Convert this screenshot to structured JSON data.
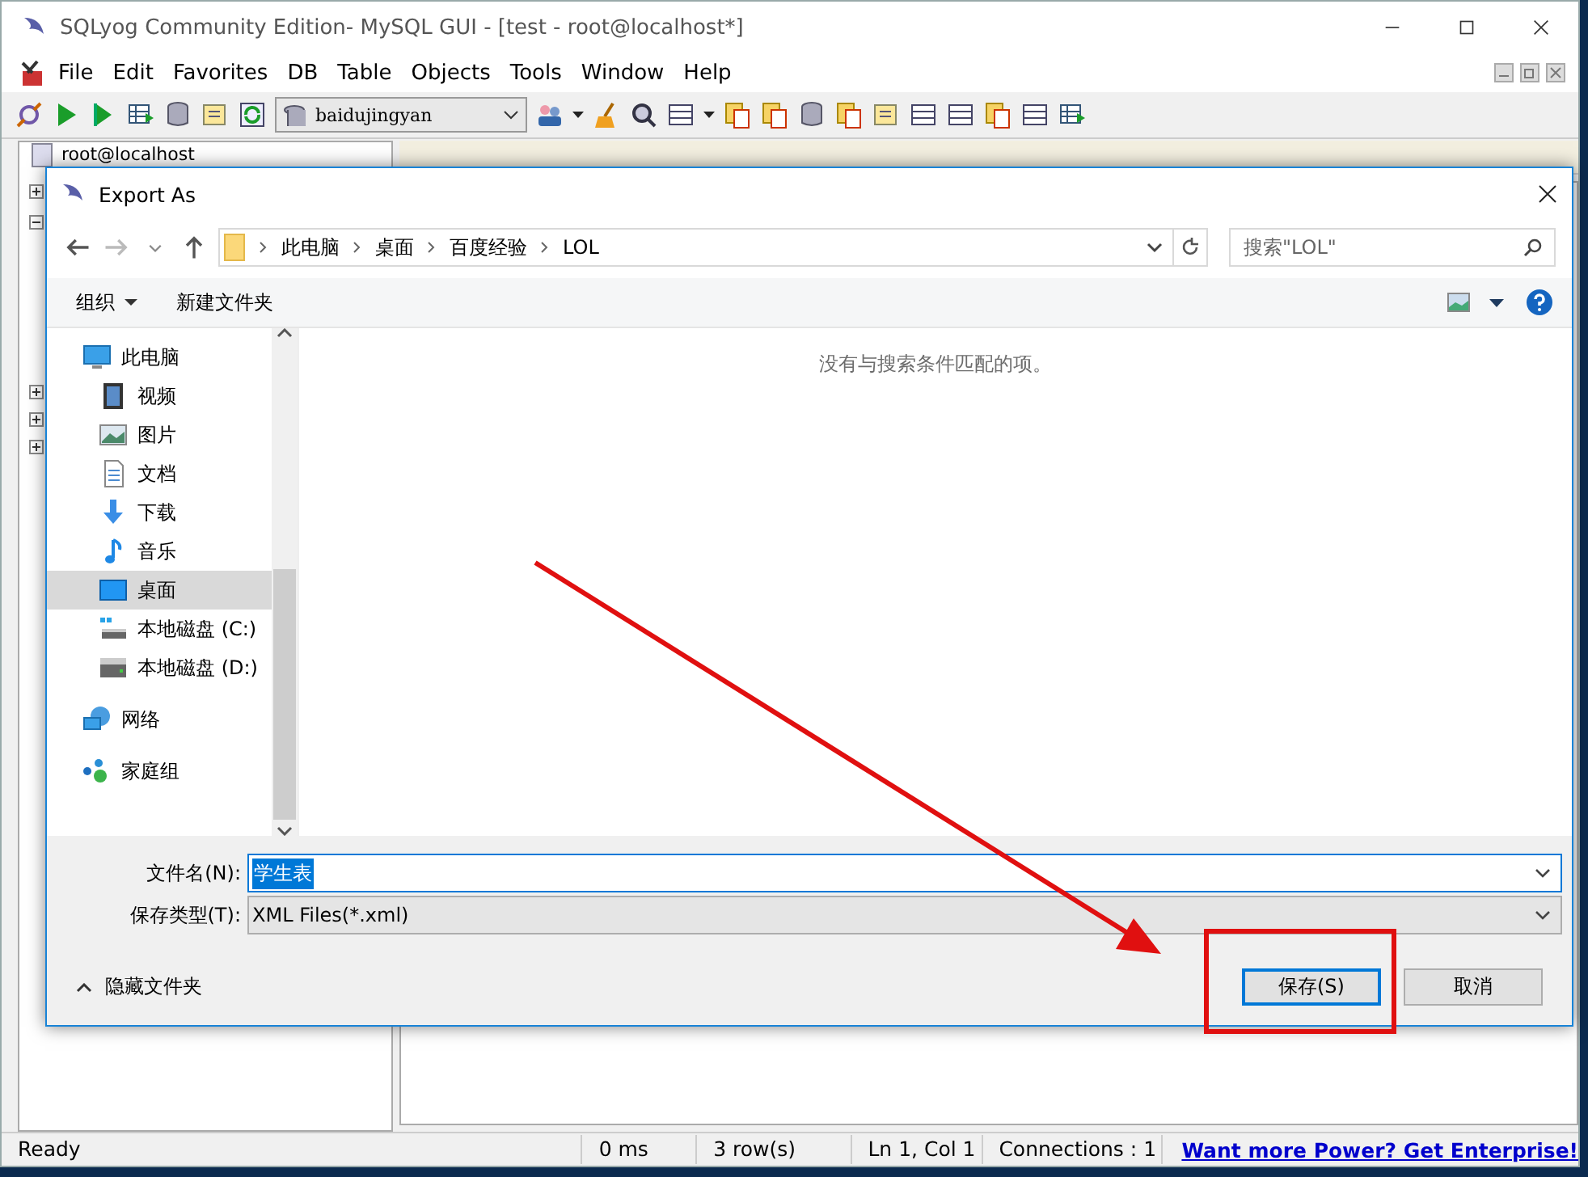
{
  "app": {
    "title": "SQLyog Community Edition- MySQL GUI - [test - root@localhost*]",
    "menu": [
      "File",
      "Edit",
      "Favorites",
      "DB",
      "Table",
      "Objects",
      "Tools",
      "Window",
      "Help"
    ],
    "database_select": "baidujingyan",
    "tree": {
      "root": "root@localhost",
      "nodes": [
        {
          "expanded": false
        },
        {
          "expanded": true
        },
        {
          "expanded": false
        },
        {
          "expanded": false
        },
        {
          "expanded": false
        }
      ]
    },
    "status_bar": [
      "Ready",
      "0 ms",
      "3 row(s)",
      "Ln 1, Col 1",
      "Connections : 1"
    ],
    "status_link": "Want more Power? Get Enterprise!"
  },
  "dialog": {
    "title": "Export As",
    "path": [
      "此电脑",
      "桌面",
      "百度经验",
      "LOL"
    ],
    "search": {
      "placeholder": "搜索\"LOL\""
    },
    "commands": [
      "组织",
      "新建文件夹"
    ],
    "empty_message": "没有与搜索条件匹配的项。",
    "nav": [
      {
        "label": "此电脑",
        "kind": "computer",
        "selected": false,
        "children": [
          {
            "label": "视频",
            "kind": "video",
            "selected": false
          },
          {
            "label": "图片",
            "kind": "pictures",
            "selected": false
          },
          {
            "label": "文档",
            "kind": "documents",
            "selected": false
          },
          {
            "label": "下载",
            "kind": "downloads",
            "selected": false
          },
          {
            "label": "音乐",
            "kind": "music",
            "selected": false
          },
          {
            "label": "桌面",
            "kind": "desktop",
            "selected": true
          },
          {
            "label": "本地磁盘 (C:)",
            "kind": "system-drive",
            "selected": false
          },
          {
            "label": "本地磁盘 (D:)",
            "kind": "drive",
            "selected": false
          }
        ]
      },
      {
        "label": "网络",
        "kind": "network",
        "selected": false
      },
      {
        "label": "家庭组",
        "kind": "homegroup",
        "selected": false
      }
    ],
    "file_name": {
      "label": "文件名(N):",
      "value": "学生表"
    },
    "file_type": {
      "label": "保存类型(T):",
      "value": "XML Files(*.xml)"
    },
    "hide_folders": "隐藏文件夹",
    "buttons": [
      {
        "label": "保存(S)",
        "default": true
      },
      {
        "label": "取消",
        "default": false
      }
    ]
  }
}
